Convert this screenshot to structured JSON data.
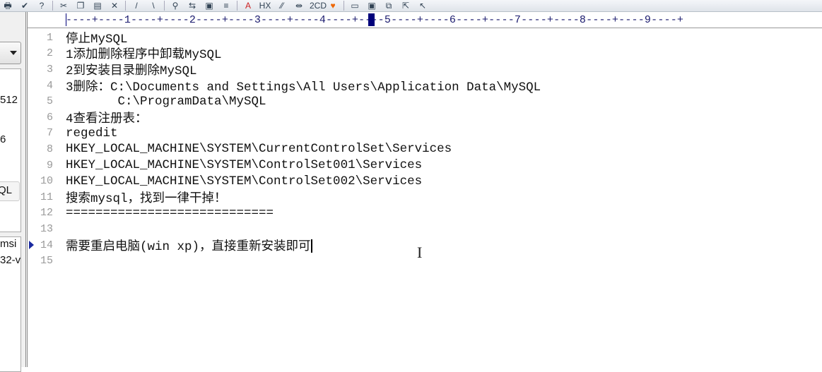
{
  "toolbar": {
    "icons": [
      "print-icon",
      "check-icon",
      "help-icon",
      "cut-icon",
      "copy-icon",
      "paste-icon",
      "delete-icon",
      "pen-icon",
      "brush-icon",
      "find-icon",
      "replace-icon",
      "goto-icon",
      "indent-icon",
      "font-icon",
      "hex-icon",
      "wrap-icon",
      "column-icon",
      "compare-icon",
      "bookmark-icon",
      "window-icon",
      "window2-icon",
      "tile-icon",
      "export-icon",
      "cursor-icon"
    ],
    "labels": {
      "hex": "HX",
      "font": "A",
      "compare": "2CD"
    }
  },
  "ruler": {
    "text": "----+----1----+----2----+----3----+----4----+----5----+----6----+----7----+----8----+----9----+"
  },
  "sidebar": {
    "fragments": [
      "512",
      "6",
      "QL",
      "msi",
      "32-v"
    ]
  },
  "editor": {
    "lines": [
      {
        "n": "1",
        "text": "停止MySQL"
      },
      {
        "n": "2",
        "text": "1添加删除程序中卸载MySQL"
      },
      {
        "n": "3",
        "text": "2到安装目录删除MySQL"
      },
      {
        "n": "4",
        "text": "3删除：C:\\Documents and Settings\\All Users\\Application Data\\MySQL"
      },
      {
        "n": "5",
        "text": "       C:\\ProgramData\\MySQL"
      },
      {
        "n": "6",
        "text": "4查看注册表："
      },
      {
        "n": "7",
        "text": "regedit"
      },
      {
        "n": "8",
        "text": "HKEY_LOCAL_MACHINE\\SYSTEM\\CurrentControlSet\\Services"
      },
      {
        "n": "9",
        "text": "HKEY_LOCAL_MACHINE\\SYSTEM\\ControlSet001\\Services"
      },
      {
        "n": "10",
        "text": "HKEY_LOCAL_MACHINE\\SYSTEM\\ControlSet002\\Services"
      },
      {
        "n": "11",
        "text": "搜索mysql，找到一律干掉！"
      },
      {
        "n": "12",
        "text": "============================"
      },
      {
        "n": "13",
        "text": ""
      },
      {
        "n": "14",
        "text": "需要重启电脑(win xp)，直接重新安装即可"
      },
      {
        "n": "15",
        "text": ""
      }
    ],
    "current_line": 14
  }
}
